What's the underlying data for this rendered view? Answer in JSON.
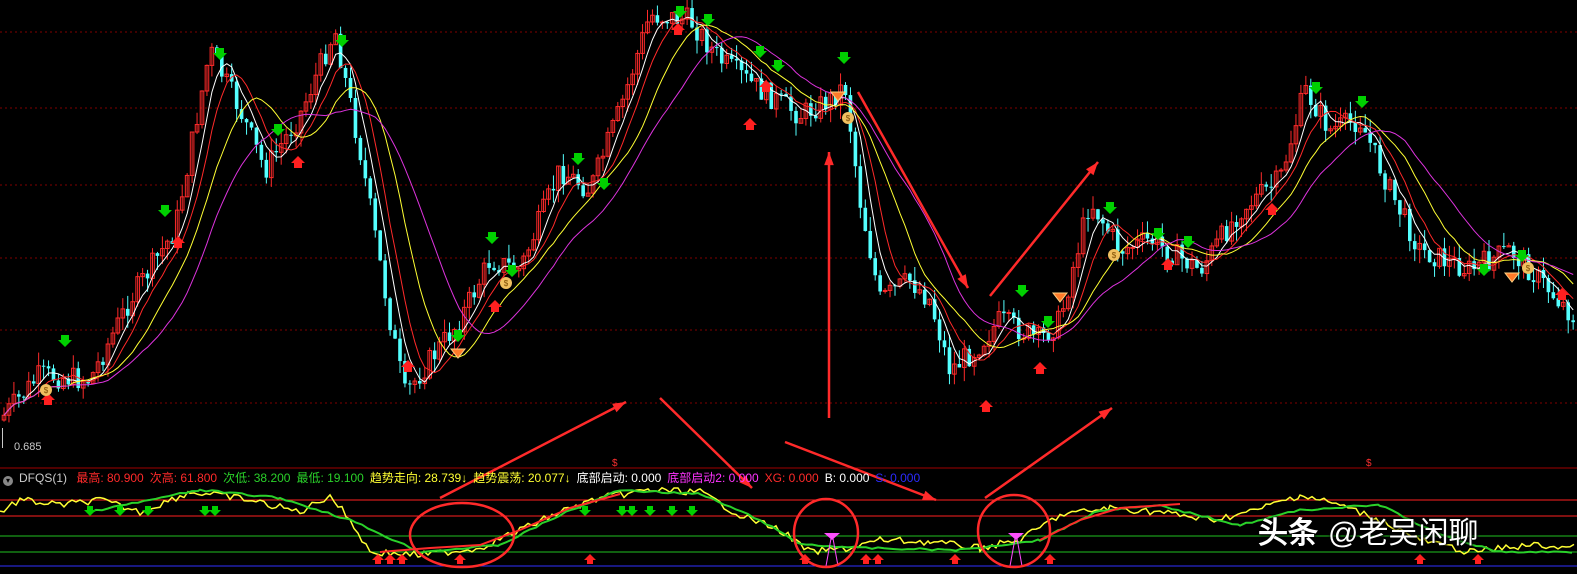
{
  "chart_data": {
    "type": "candlestick",
    "price_axis": {
      "min_tick_label": "0.685"
    },
    "indicator": {
      "name": "DFQS(1)",
      "items": [
        {
          "label": "最高:",
          "value": "80.900",
          "color": "#ff2a2a"
        },
        {
          "label": "次高:",
          "value": "61.800",
          "color": "#ff2a2a"
        },
        {
          "label": "次低:",
          "value": "38.200",
          "color": "#2ad12a"
        },
        {
          "label": "最低:",
          "value": "19.100",
          "color": "#2ad12a"
        },
        {
          "label": "趋势走向:",
          "value": "28.739",
          "color": "#ffff33",
          "suffix": "↓"
        },
        {
          "label": "趋势震荡:",
          "value": "20.077",
          "color": "#ffff33",
          "suffix": "↓"
        },
        {
          "label": "底部启动:",
          "value": "0.000",
          "color": "#ffffff"
        },
        {
          "label": "底部启动2:",
          "value": "0.000",
          "color": "#ff33ff"
        },
        {
          "label": "XG:",
          "value": "0.000",
          "color": "#ff2a2a"
        },
        {
          "label": "B:",
          "value": "0.000",
          "color": "#ffffff"
        },
        {
          "label": "S:",
          "value": "0.000",
          "color": "#2b2bff"
        }
      ],
      "levels": [
        80.9,
        61.8,
        38.2,
        19.1
      ]
    },
    "colors": {
      "up": "#ff2a2a",
      "down": "#54ffff",
      "ma_fast": "#ff2a2a",
      "ma_slow": "#dd33dd",
      "trend": "#ffff33",
      "osc": "#2ad12a",
      "grid": "#800000",
      "annotation": "#ff2a2a"
    }
  },
  "watermark": {
    "brand": "头条",
    "handle": "@老吴闲聊"
  }
}
